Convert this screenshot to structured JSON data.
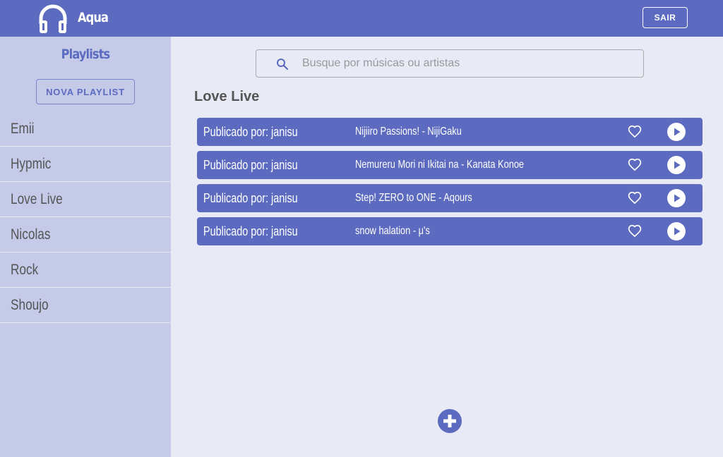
{
  "header": {
    "app_title": "Aqua",
    "logout_label": "SAIR",
    "logo_icon": "headphones-icon"
  },
  "sidebar": {
    "title": "Playlists",
    "new_playlist_label": "NOVA PLAYLIST",
    "items": [
      {
        "label": "Emii"
      },
      {
        "label": "Hypmic"
      },
      {
        "label": "Love Live"
      },
      {
        "label": "Nicolas"
      },
      {
        "label": "Rock"
      },
      {
        "label": "Shoujo"
      }
    ]
  },
  "search": {
    "placeholder": "Busque por músicas ou artistas",
    "value": ""
  },
  "main": {
    "playlist_title": "Love Live",
    "songs": [
      {
        "publisher": "Publicado por: janisu",
        "title": "Nijiiro Passions! - NijiGaku"
      },
      {
        "publisher": "Publicado por: janisu",
        "title": "Nemureru Mori ni Ikitai na - Kanata Konoe"
      },
      {
        "publisher": "Publicado por: janisu",
        "title": "Step! ZERO to ONE - Aqours"
      },
      {
        "publisher": "Publicado por: janisu",
        "title": "snow halation - μ's"
      }
    ]
  },
  "colors": {
    "primary": "#5c6bc0",
    "sidebar_bg": "#c5cae9",
    "page_bg": "#e8eaf6"
  }
}
